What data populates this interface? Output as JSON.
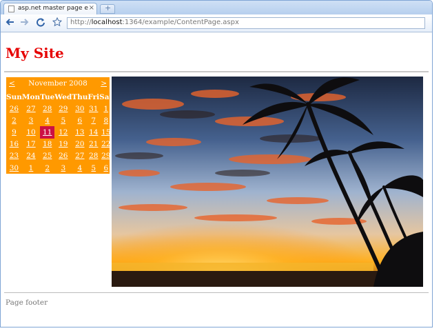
{
  "browser": {
    "tab_title": "asp.net master page exam...",
    "tab_close": "×",
    "new_tab": "+",
    "url_scheme": "http://",
    "url_host": "localhost",
    "url_path": ":1364/example/ContentPage.aspx"
  },
  "page": {
    "site_title": "My Site",
    "footer": "Page footer"
  },
  "calendar": {
    "prev": "<",
    "next": ">",
    "month": "November 2008",
    "selected_day": "11",
    "day_names": [
      "Sun",
      "Mon",
      "Tue",
      "Wed",
      "Thu",
      "Fri",
      "Sat"
    ],
    "weeks": [
      [
        "26",
        "27",
        "28",
        "29",
        "30",
        "31",
        "1"
      ],
      [
        "2",
        "3",
        "4",
        "5",
        "6",
        "7",
        "8"
      ],
      [
        "9",
        "10",
        "11",
        "12",
        "13",
        "14",
        "15"
      ],
      [
        "16",
        "17",
        "18",
        "19",
        "20",
        "21",
        "22"
      ],
      [
        "23",
        "24",
        "25",
        "26",
        "27",
        "28",
        "29"
      ],
      [
        "30",
        "1",
        "2",
        "3",
        "4",
        "5",
        "6"
      ]
    ]
  },
  "colors": {
    "site_title": "#e60000",
    "calendar_bg": "#ff9900",
    "selected_day_bg": "#cc1144"
  }
}
